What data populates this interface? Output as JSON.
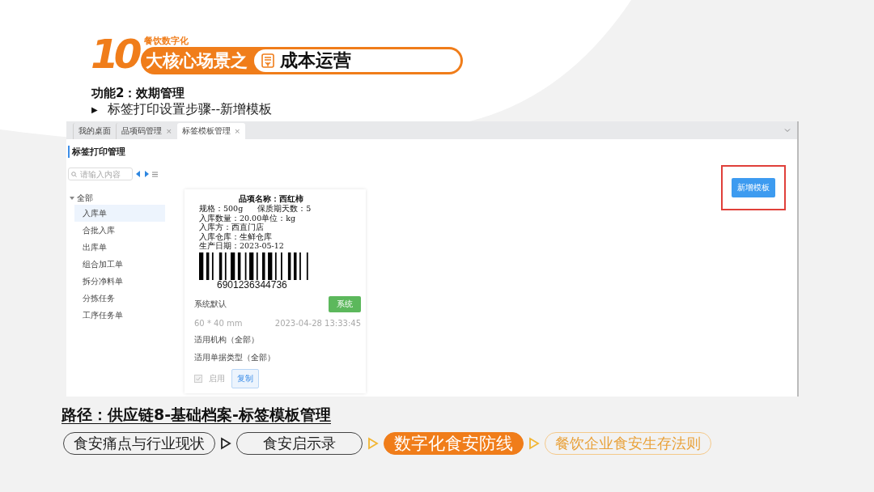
{
  "header": {
    "logo": "10",
    "brand": "餐饮数字化",
    "title": "大核心场景之",
    "topic": "成本运营"
  },
  "section": {
    "title": "功能2：效期管理",
    "bullet": "▶",
    "step": "标签打印设置步骤--新增模板"
  },
  "app": {
    "tabs": [
      {
        "label": "我的桌面",
        "selected": false
      },
      {
        "label": "品项码管理",
        "close": "×",
        "selected": false
      },
      {
        "label": "标签模板管理",
        "close": "×",
        "selected": true
      }
    ],
    "panel_title": "标签打印管理",
    "search": {
      "placeholder": "请输入内容"
    },
    "tree": [
      {
        "label": "全部",
        "expanded": true,
        "selected": false,
        "children": [
          {
            "label": "入库单",
            "selected": true
          },
          {
            "label": "合批入库",
            "selected": false
          },
          {
            "label": "出库单",
            "selected": false
          },
          {
            "label": "组合加工单",
            "selected": false
          },
          {
            "label": "拆分净料单",
            "selected": false
          },
          {
            "label": "分拣任务",
            "selected": false
          },
          {
            "label": "工序任务单",
            "selected": false
          }
        ]
      }
    ],
    "template_card": {
      "label_lines": [
        {
          "kind": "title",
          "text": "品项名称：西红柿"
        },
        {
          "kind": "pair",
          "text": "规格：500g",
          "text2": "保质期天数：5"
        },
        {
          "kind": "line",
          "text": "入库数量：20.00单位：kg"
        },
        {
          "kind": "line",
          "text": "入库方：西直门店"
        },
        {
          "kind": "line",
          "text": "入库仓库：生鲜仓库"
        },
        {
          "kind": "line",
          "text": "生产日期：2023-05-12"
        }
      ],
      "barcode_number": "6901236344736",
      "name": "系统默认",
      "badge": "系统",
      "size": "60 * 40 mm",
      "date": "2023-04-28 13:33:45",
      "org": "适用机构（全部）",
      "doc_type": "适用单据类型（全部）",
      "enabled": {
        "label": "启用",
        "checked": true,
        "disabled": true
      },
      "copy_button": "复制"
    },
    "add_button": {
      "label": "新增模板",
      "highlighted": true
    }
  },
  "path": "路径：供应链8-基础档案-标签模板管理",
  "nav": [
    {
      "label": "食安痛点与行业现状",
      "kind": "done"
    },
    {
      "label": "食安启示录",
      "kind": "done"
    },
    {
      "label": "数字化食安防线",
      "kind": "current"
    },
    {
      "label": "餐饮企业食安生存法则",
      "kind": "next"
    }
  ]
}
